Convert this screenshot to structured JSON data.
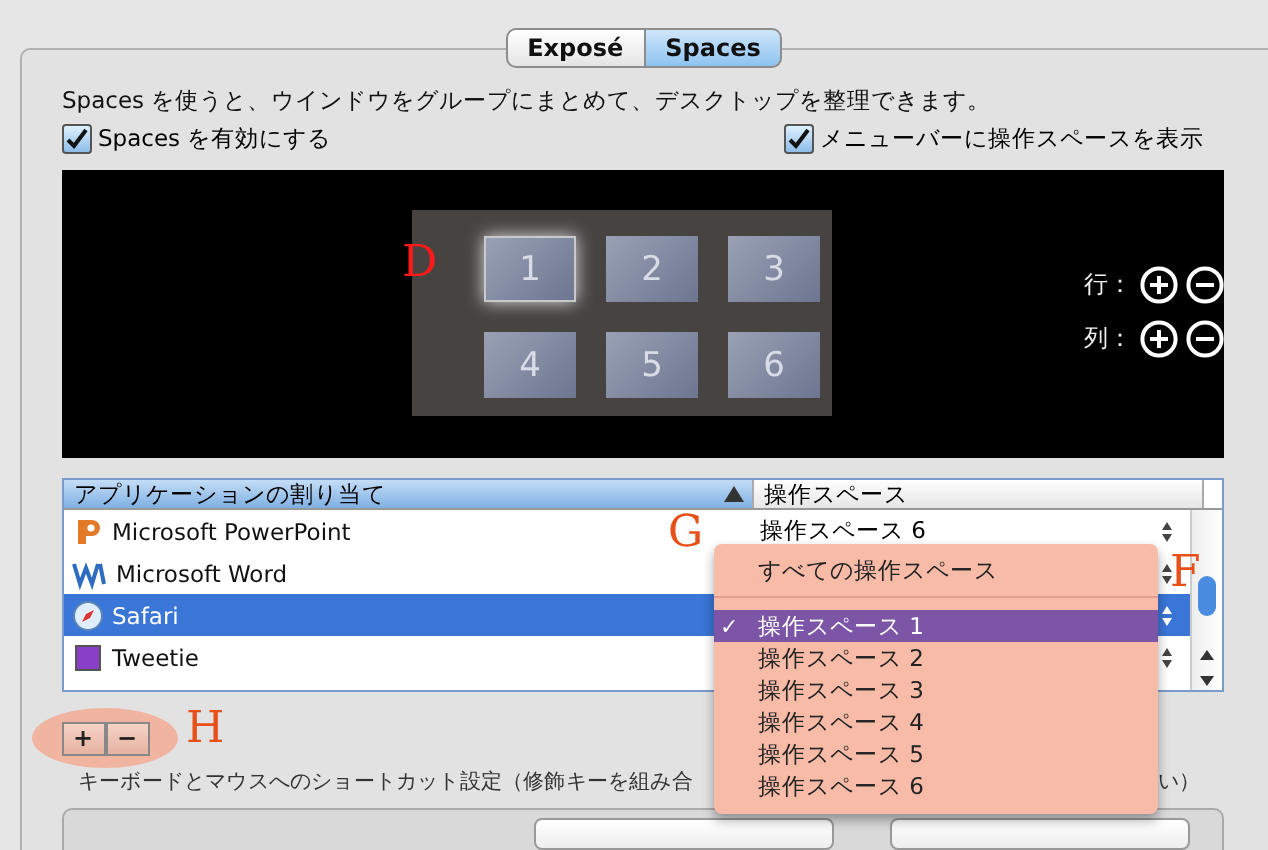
{
  "tabs": [
    {
      "label": "Exposé",
      "selected": false
    },
    {
      "label": "Spaces",
      "selected": true
    }
  ],
  "description": "Spaces を使うと、ウインドウをグループにまとめて、デスクトップを整理できます。",
  "options": [
    {
      "label": "Spaces を有効にする",
      "checked": true
    },
    {
      "label": "メニューバーに操作スペースを表示",
      "checked": true
    }
  ],
  "spaces_grid": {
    "marker": "D",
    "spaces": [
      {
        "label": "1",
        "selected": true
      },
      {
        "label": "2",
        "selected": false
      },
      {
        "label": "3",
        "selected": false
      },
      {
        "label": "4",
        "selected": false
      },
      {
        "label": "5",
        "selected": false
      },
      {
        "label": "6",
        "selected": false
      }
    ],
    "rows_label": "行：",
    "columns_label": "列："
  },
  "table": {
    "columns": [
      {
        "label": "アプリケーションの割り当て",
        "sorted": true
      },
      {
        "label": "操作スペース",
        "sorted": false
      }
    ],
    "rows": [
      {
        "app": "Microsoft PowerPoint",
        "kind": "powerpoint",
        "space": "操作スペース 6",
        "selected": false
      },
      {
        "app": "Microsoft Word",
        "kind": "word",
        "selected": false
      },
      {
        "app": "Safari",
        "kind": "safari",
        "selected": true
      },
      {
        "app": "Tweetie",
        "kind": "tweetie",
        "selected": false
      }
    ]
  },
  "popup_menu": {
    "marker_left": "G",
    "marker_right": "F",
    "items": [
      {
        "label": "すべての操作スペース",
        "checked": false,
        "kind": "all"
      },
      {
        "label": "操作スペース 1",
        "checked": true,
        "kind": "space"
      },
      {
        "label": "操作スペース 2",
        "checked": false,
        "kind": "space"
      },
      {
        "label": "操作スペース 3",
        "checked": false,
        "kind": "space"
      },
      {
        "label": "操作スペース 4",
        "checked": false,
        "kind": "space"
      },
      {
        "label": "操作スペース 5",
        "checked": false,
        "kind": "space"
      },
      {
        "label": "操作スペース 6",
        "checked": false,
        "kind": "space"
      }
    ],
    "check_mark": "✓"
  },
  "add_remove": {
    "marker": "H",
    "buttons": [
      "+",
      "−"
    ]
  },
  "shortcut_label": "キーボードとマウスへのショートカット設定（修飾キーを組み合",
  "shortcut_label_tail": "い）"
}
